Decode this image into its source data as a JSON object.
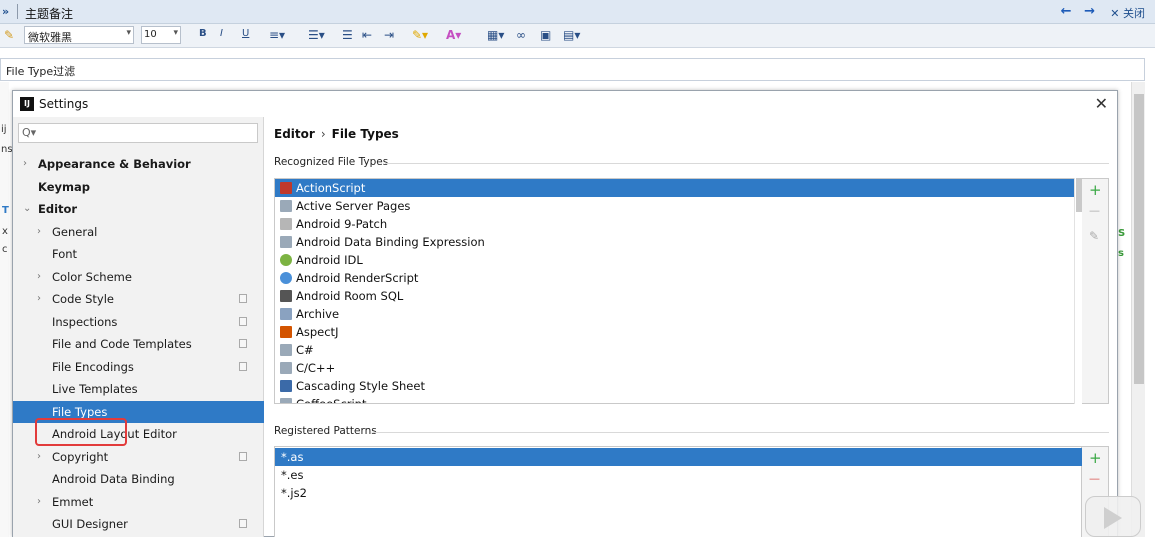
{
  "host": {
    "expand_glyph": "»",
    "title": "主题备注",
    "nav_back": "←",
    "nav_forward": "→",
    "close_label": "✕ 关闭",
    "font_value": "微软雅黑",
    "size_value": "10",
    "toolbar_bold": "B",
    "toolbar_italic": "I",
    "toolbar_underline": "U",
    "filter_text": "File Type过滤",
    "frag_1": "ij",
    "frag_2": "ns",
    "frag_3": "T",
    "frag_4": "x",
    "frag_5": "c",
    "frag_6": "S",
    "frag_7": "s"
  },
  "dialog": {
    "logo_text": "IJ",
    "title": "Settings",
    "close_glyph": "✕",
    "search_icon_glyph": "Q▾",
    "breadcrumb": {
      "part1": "Editor",
      "sep": "›",
      "part2": "File Types"
    },
    "recognized_label": "Recognized File Types",
    "patterns_label": "Registered Patterns"
  },
  "tree": [
    {
      "label": "Appearance & Behavior",
      "arrow": "›",
      "bold": true
    },
    {
      "label": "Keymap",
      "arrow": "",
      "bold": true
    },
    {
      "label": "Editor",
      "arrow": "⌄",
      "bold": true
    },
    {
      "label": "General",
      "arrow": "›",
      "bold": false
    },
    {
      "label": "Font",
      "arrow": "",
      "bold": false
    },
    {
      "label": "Color Scheme",
      "arrow": "›",
      "bold": false
    },
    {
      "label": "Code Style",
      "arrow": "›",
      "bold": false,
      "copy": true
    },
    {
      "label": "Inspections",
      "arrow": "",
      "bold": false,
      "copy": true
    },
    {
      "label": "File and Code Templates",
      "arrow": "",
      "bold": false,
      "copy": true
    },
    {
      "label": "File Encodings",
      "arrow": "",
      "bold": false,
      "copy": true
    },
    {
      "label": "Live Templates",
      "arrow": "",
      "bold": false
    },
    {
      "label": "File Types",
      "arrow": "",
      "bold": false,
      "selected": true
    },
    {
      "label": "Android Layout Editor",
      "arrow": "",
      "bold": false
    },
    {
      "label": "Copyright",
      "arrow": "›",
      "bold": false,
      "copy": true
    },
    {
      "label": "Android Data Binding",
      "arrow": "",
      "bold": false
    },
    {
      "label": "Emmet",
      "arrow": "›",
      "bold": false
    },
    {
      "label": "GUI Designer",
      "arrow": "",
      "bold": false,
      "copy": true
    }
  ],
  "file_types": [
    {
      "name": "ActionScript",
      "icon": "actionscript-icon",
      "color": "#c0392b",
      "selected": true
    },
    {
      "name": "Active Server Pages",
      "icon": "file-icon",
      "color": "#9aa9b8"
    },
    {
      "name": "Android 9-Patch",
      "icon": "folder-icon",
      "color": "#b6b6b6"
    },
    {
      "name": "Android Data Binding Expression",
      "icon": "file-icon",
      "color": "#9aa9b8"
    },
    {
      "name": "Android IDL",
      "icon": "android-icon",
      "color": "#7cb342"
    },
    {
      "name": "Android RenderScript",
      "icon": "renderscript-icon",
      "color": "#4a90d9"
    },
    {
      "name": "Android Room SQL",
      "icon": "database-icon",
      "color": "#555555"
    },
    {
      "name": "Archive",
      "icon": "archive-icon",
      "color": "#8aa2c0"
    },
    {
      "name": "AspectJ",
      "icon": "aspectj-icon",
      "color": "#d35400"
    },
    {
      "name": "C#",
      "icon": "file-icon",
      "color": "#9aa9b8"
    },
    {
      "name": "C/C++",
      "icon": "file-icon",
      "color": "#9aa9b8"
    },
    {
      "name": "Cascading Style Sheet",
      "icon": "css-icon",
      "color": "#3b6aa8"
    },
    {
      "name": "CoffeeScript",
      "icon": "file-icon",
      "color": "#9aa9b8"
    }
  ],
  "patterns": [
    {
      "value": "*.as",
      "selected": true
    },
    {
      "value": "*.es"
    },
    {
      "value": "*.js2"
    }
  ],
  "tools": {
    "add": "+",
    "remove": "—",
    "edit": "✎"
  },
  "colors": {
    "accent": "#2f7ac6",
    "highlight": "#e23b3b",
    "add": "#3aa845",
    "remove": "#d9534f"
  }
}
